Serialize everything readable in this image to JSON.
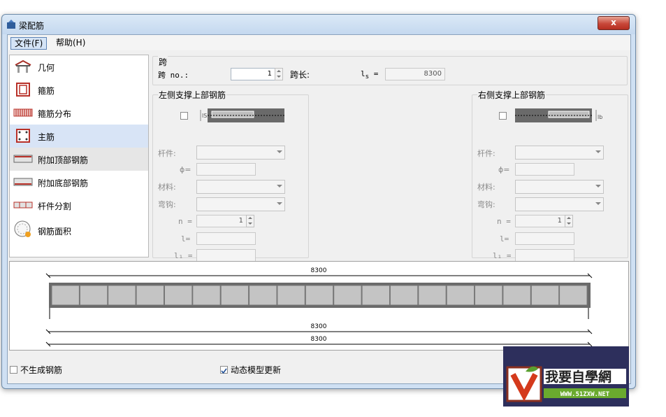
{
  "window": {
    "title": "梁配筋",
    "close_glyph": "x"
  },
  "menu": {
    "file": "文件(F)",
    "help": "帮助(H)"
  },
  "nav": [
    {
      "label": "几何",
      "icon": "geometry-icon"
    },
    {
      "label": "箍筋",
      "icon": "stirrup-icon"
    },
    {
      "label": "箍筋分布",
      "icon": "stirrup-distribution-icon"
    },
    {
      "label": "主筋",
      "icon": "main-rebar-icon"
    },
    {
      "label": "附加顶部钢筋",
      "icon": "top-rebar-icon"
    },
    {
      "label": "附加底部钢筋",
      "icon": "bottom-rebar-icon"
    },
    {
      "label": "杆件分割",
      "icon": "member-split-icon"
    },
    {
      "label": "钢筋面积",
      "icon": "rebar-area-icon"
    }
  ],
  "span": {
    "group_title": "跨",
    "span_no_label": "跨 no.:",
    "span_no_value": "1",
    "span_length_label": "跨长:",
    "ls_label": "l",
    "ls_sub": "s",
    "ls_eq": "=",
    "ls_value": "8300"
  },
  "left_support": {
    "title": "左侧支撑上部钢筋",
    "member_label": "杆件:",
    "phi_label": "ϕ=",
    "material_label": "材料:",
    "hook_label": "弯钩:",
    "n_label": "n =",
    "n_value": "1",
    "l_label": "l=",
    "l1_label": "l₁ ="
  },
  "right_support": {
    "title": "右侧支撑上部钢筋",
    "member_label": "杆件:",
    "phi_label": "ϕ=",
    "material_label": "材料:",
    "hook_label": "弯钩:",
    "n_label": "n =",
    "n_value": "1",
    "l_label": "l=",
    "l1_label": "l₁ ="
  },
  "preview": {
    "top_dim": "8300",
    "mid_dim": "8300",
    "bottom_dim": "8300",
    "segments": 19
  },
  "bottom": {
    "no_rebar": "不生成钢筋",
    "no_rebar_checked": false,
    "dynamic_update": "动态模型更新",
    "dynamic_update_checked": true
  },
  "watermark": {
    "text": "我要自學網",
    "url": "WWW.51ZXW.NET"
  },
  "colors": {
    "selected_nav": "#d8e4f6",
    "rebar_red": "#c0302a",
    "close_red": "#c8483a"
  }
}
